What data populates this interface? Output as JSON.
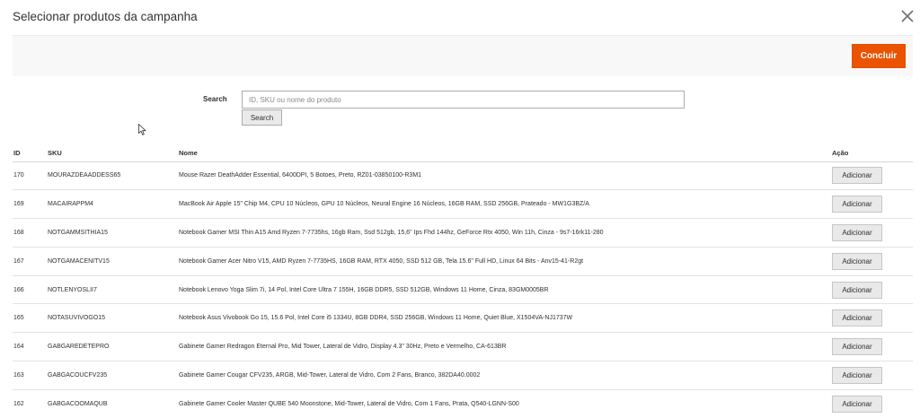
{
  "modal": {
    "title": "Selecionar produtos da campanha",
    "conclude_label": "Concluir"
  },
  "search": {
    "label": "Search",
    "placeholder": "ID, SKU ou nome do produto",
    "button_label": "Search"
  },
  "table": {
    "headers": {
      "id": "ID",
      "sku": "SKU",
      "name": "Nome",
      "action": "Ação"
    },
    "add_label": "Adicionar",
    "rows": [
      {
        "id": "170",
        "sku": "MOURAZDEAADDESS65",
        "name": "Mouse Razer DeathAdder Essential, 6400DPI, 5 Botoes, Preto, RZ01-03850100-R3M1"
      },
      {
        "id": "169",
        "sku": "MACAIRAPPM4",
        "name": "MacBook Air Apple 15\" Chip M4, CPU 10 Núcleos, GPU 10 Núcleos, Neural Engine 16 Núcleos, 16GB RAM, SSD 256GB, Prateado - MW1G3BZ/A"
      },
      {
        "id": "168",
        "sku": "NOTGAMMSITHIA15",
        "name": "Notebook Gamer MSI Thin A15 Amd Ryzen 7-7735hs, 16gb Ram, Ssd 512gb, 15,6\" Ips Fhd 144hz, GeForce Rtx 4050, Win 11h, Cinza - 9s7-16rk11-280"
      },
      {
        "id": "167",
        "sku": "NOTGAMACENITV15",
        "name": "Notebook Gamer Acer Nitro V15, AMD Ryzen 7-7735HS, 16GB RAM, RTX 4050, SSD 512 GB, Tela 15.6\" Full HD, Linux 64 Bits - Anv15-41-R2gt"
      },
      {
        "id": "166",
        "sku": "NOTLENYOSLII7",
        "name": "Notebook Lenovo Yoga Slim 7i, 14 Pol, Intel Core Ultra 7 155H, 16GB DDR5, SSD 512GB, Windows 11 Home, Cinza, 83GM0005BR"
      },
      {
        "id": "165",
        "sku": "NOTASUVIVOGO15",
        "name": "Notebook Asus Vivobook Go 15, 15.6 Pol, Intel Core i5 1334U, 8GB DDR4, SSD 256GB, Windows 11 Home, Quiet Blue, X1504VA-NJ1737W"
      },
      {
        "id": "164",
        "sku": "GABGAREDETEPRO",
        "name": "Gabinete Gamer Redragon Eternal Pro, Mid Tower, Lateral de Vidro, Display 4.3\" 30Hz, Preto e Vermelho, CA-613BR"
      },
      {
        "id": "163",
        "sku": "GABGACOUCFV235",
        "name": "Gabinete Gamer Cougar CFV235, ARGB, Mid-Tower, Lateral de Vidro, Com 2 Fans, Branco, 382DA40.0002"
      },
      {
        "id": "162",
        "sku": "GABGACOOMAQUB",
        "name": "Gabinete Gamer Cooler Master QUBE 540 Moonstone, Mid-Tower, Lateral de Vidro, Com 1 Fans, Prata, Q540-LGNN-S00"
      }
    ]
  },
  "colors": {
    "accent": "#eb5202"
  }
}
